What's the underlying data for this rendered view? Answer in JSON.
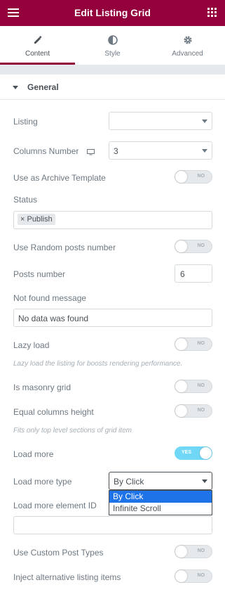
{
  "header": {
    "title": "Edit Listing Grid",
    "menu_icon": "hamburger-icon",
    "apps_icon": "grid-icon",
    "color": "#93003c"
  },
  "tabs": [
    {
      "label": "Content",
      "icon": "pencil-icon",
      "active": true
    },
    {
      "label": "Style",
      "icon": "half-circle-icon",
      "active": false
    },
    {
      "label": "Advanced",
      "icon": "gear-icon",
      "active": false
    }
  ],
  "section": {
    "title": "General"
  },
  "controls": {
    "listing": {
      "label": "Listing",
      "value": ""
    },
    "columns": {
      "label": "Columns Number",
      "value": "3",
      "icon": "desktop-icon"
    },
    "archive": {
      "label": "Use as Archive Template",
      "toggle": "NO"
    },
    "status": {
      "label": "Status",
      "tag": "× Publish"
    },
    "random": {
      "label": "Use Random posts number",
      "toggle": "NO"
    },
    "posts_number": {
      "label": "Posts number",
      "value": "6"
    },
    "not_found": {
      "label": "Not found message",
      "value": "No data was found"
    },
    "lazy": {
      "label": "Lazy load",
      "toggle": "NO",
      "note": "Lazy load the listing for boosts rendering performance."
    },
    "masonry": {
      "label": "Is masonry grid",
      "toggle": "NO"
    },
    "equal": {
      "label": "Equal columns height",
      "toggle": "NO",
      "note": "Fits only top level sections of grid item"
    },
    "load_more": {
      "label": "Load more",
      "toggle": "YES"
    },
    "load_more_type": {
      "label": "Load more type",
      "value": "By Click",
      "options": [
        "By Click",
        "Infinite Scroll"
      ]
    },
    "load_more_id": {
      "label": "Load more element ID",
      "value": ""
    },
    "custom_post": {
      "label": "Use Custom Post Types",
      "toggle": "NO"
    },
    "inject": {
      "label": "Inject alternative listing items",
      "toggle": "NO"
    }
  }
}
